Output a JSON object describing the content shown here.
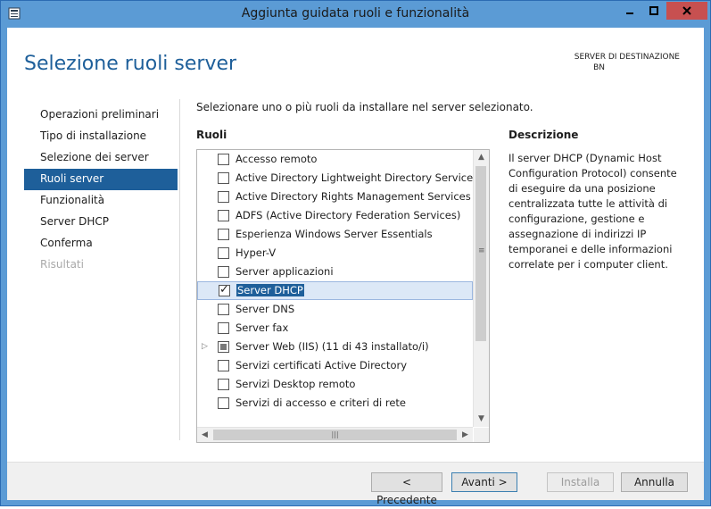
{
  "window": {
    "title": "Aggiunta guidata ruoli e funzionalità",
    "controls": [
      "minimize-icon",
      "maximize-icon",
      "close-icon"
    ]
  },
  "header": {
    "title": "Selezione ruoli server",
    "destination_label": "SERVER DI DESTINAZIONE",
    "destination_server": "BN"
  },
  "nav": {
    "items": [
      {
        "label": "Operazioni preliminari",
        "state": "normal"
      },
      {
        "label": "Tipo di installazione",
        "state": "normal"
      },
      {
        "label": "Selezione dei server",
        "state": "normal"
      },
      {
        "label": "Ruoli server",
        "state": "selected"
      },
      {
        "label": "Funzionalità",
        "state": "normal"
      },
      {
        "label": "Server DHCP",
        "state": "normal"
      },
      {
        "label": "Conferma",
        "state": "normal"
      },
      {
        "label": "Risultati",
        "state": "disabled"
      }
    ]
  },
  "main": {
    "instruction": "Selezionare uno o più ruoli da installare nel server selezionato.",
    "roles_heading": "Ruoli",
    "roles": [
      {
        "label": "Accesso remoto",
        "checked": false
      },
      {
        "label": "Active Directory Lightweight Directory Services",
        "checked": false
      },
      {
        "label": "Active Directory Rights Management Services",
        "checked": false
      },
      {
        "label": "ADFS (Active Directory Federation Services)",
        "checked": false
      },
      {
        "label": "Esperienza Windows Server Essentials",
        "checked": false
      },
      {
        "label": "Hyper-V",
        "checked": false
      },
      {
        "label": "Server applicazioni",
        "checked": false
      },
      {
        "label": "Server DHCP",
        "checked": true,
        "selected": true
      },
      {
        "label": "Server DNS",
        "checked": false
      },
      {
        "label": "Server fax",
        "checked": false
      },
      {
        "label": "Server Web (IIS) (11 di 43 installato/i)",
        "checked": "partial",
        "expandable": true
      },
      {
        "label": "Servizi certificati Active Directory",
        "checked": false
      },
      {
        "label": "Servizi Desktop remoto",
        "checked": false
      },
      {
        "label": "Servizi di accesso e criteri di rete",
        "checked": false
      }
    ],
    "description_heading": "Descrizione",
    "description_text": "Il server DHCP (Dynamic Host Configuration Protocol) consente di eseguire da una posizione centralizzata tutte le attività di configurazione, gestione e assegnazione di indirizzi IP temporanei e delle informazioni correlate per i computer client."
  },
  "footer": {
    "previous": "< Precedente",
    "next": "Avanti >",
    "install": "Installa",
    "cancel": "Annulla"
  },
  "colors": {
    "titlebar": "#5b9bd5",
    "accent": "#1e5f9a",
    "close_button": "#c75050"
  }
}
